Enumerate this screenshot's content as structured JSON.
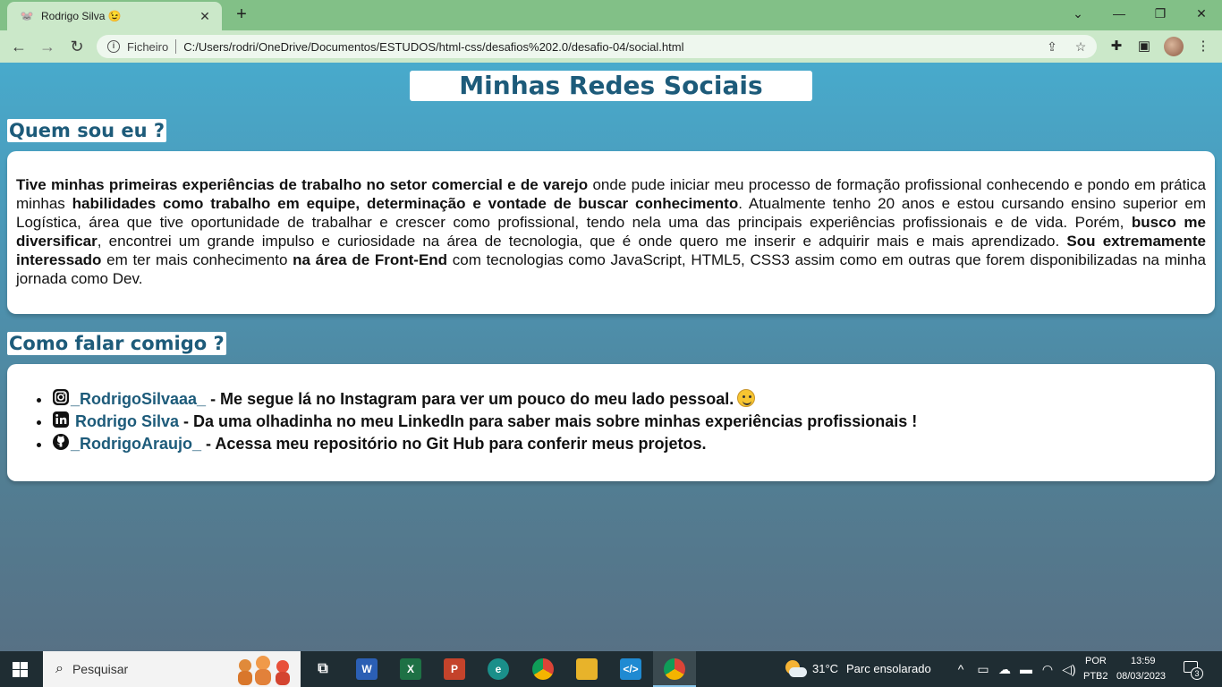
{
  "browser": {
    "tab_title": "Rodrigo Silva 😉",
    "favicon": "🐭",
    "new_tab": "+",
    "close_tab": "✕",
    "address_scheme": "Ficheiro",
    "address_url": "C:/Users/rodri/OneDrive/Documentos/ESTUDOS/html-css/desafios%202.0/desafio-04/social.html"
  },
  "page": {
    "title": "Minhas Redes Sociais",
    "about_heading": "Quem sou eu ?",
    "about_parts": [
      "Tive minhas primeiras experiências de trabalho no setor comercial e de varejo",
      " onde pude iniciar meu processo de formação profissional conhecendo e pondo em prática minhas ",
      "habilidades como trabalho em equipe, determinação e vontade de buscar conhecimento",
      ". Atualmente tenho 20 anos e estou cursando ensino superior em Logística, área que tive oportunidade de trabalhar e crescer como profissional, tendo nela uma das principais experiências profissionais e de vida. Porém, ",
      "busco me diversificar",
      ", encontrei um grande impulso e curiosidade na área de tecnologia, que é onde quero me inserir e adquirir mais e mais aprendizado. ",
      "Sou extremamente interessado",
      " em ter mais conhecimento ",
      "na área de Front-End",
      " com tecnologias como JavaScript, HTML5, CSS3 assim como em outras que forem disponibilizadas na minha jornada como Dev."
    ],
    "contact_heading": "Como falar comigo ?",
    "contacts": [
      {
        "icon": "instagram-icon",
        "link": "_RodrigoSilvaaa_",
        "text": " - Me segue lá no Instagram para ver um pouco do meu lado pessoal."
      },
      {
        "icon": "linkedin-icon",
        "link": "Rodrigo Silva",
        "text": " - Da uma olhadinha no meu LinkedIn para saber mais sobre minhas experiências profissionais !"
      },
      {
        "icon": "github-icon",
        "link": "_RodrigoAraujo_",
        "text": " - Acessa meu repositório no Git Hub para conferir meus projetos."
      }
    ]
  },
  "taskbar": {
    "search_placeholder": "Pesquisar",
    "weather_temp": "31°C",
    "weather_desc": "Parc ensolarado",
    "lang_top": "POR",
    "lang_bottom": "PTB2",
    "time": "13:59",
    "date": "08/03/2023",
    "notifications": "3"
  },
  "colors": {
    "accent": "#1d5b7a",
    "tab_bg": "#82c087",
    "toolbar_bg": "#cbe8c9"
  }
}
